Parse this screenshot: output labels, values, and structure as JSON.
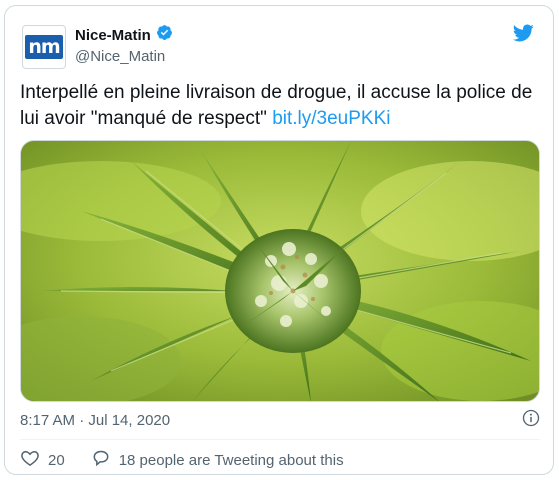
{
  "author": {
    "display_name": "Nice-Matin",
    "handle": "@Nice_Matin",
    "avatar_text": "nm",
    "verified": true
  },
  "tweet": {
    "text": "Interpellé en pleine livraison de drogue, il accuse la police de lui avoir \"manqué de respect\" ",
    "link_text": "bit.ly/3euPKKi",
    "timestamp": "8:17 AM · Jul 14, 2020"
  },
  "actions": {
    "likes_count": "20",
    "retweet_text": "18 people are Tweeting about this"
  },
  "icons": {
    "brand": "twitter-bird-icon",
    "verified": "verified-badge-icon",
    "info": "info-icon",
    "like": "heart-icon",
    "reply": "speech-bubble-icon"
  },
  "colors": {
    "accent": "#1d9bf0",
    "text": "#0f1419",
    "secondary_text": "#536471",
    "border": "#cfd9de",
    "avatar_bg": "#1b5eab"
  }
}
